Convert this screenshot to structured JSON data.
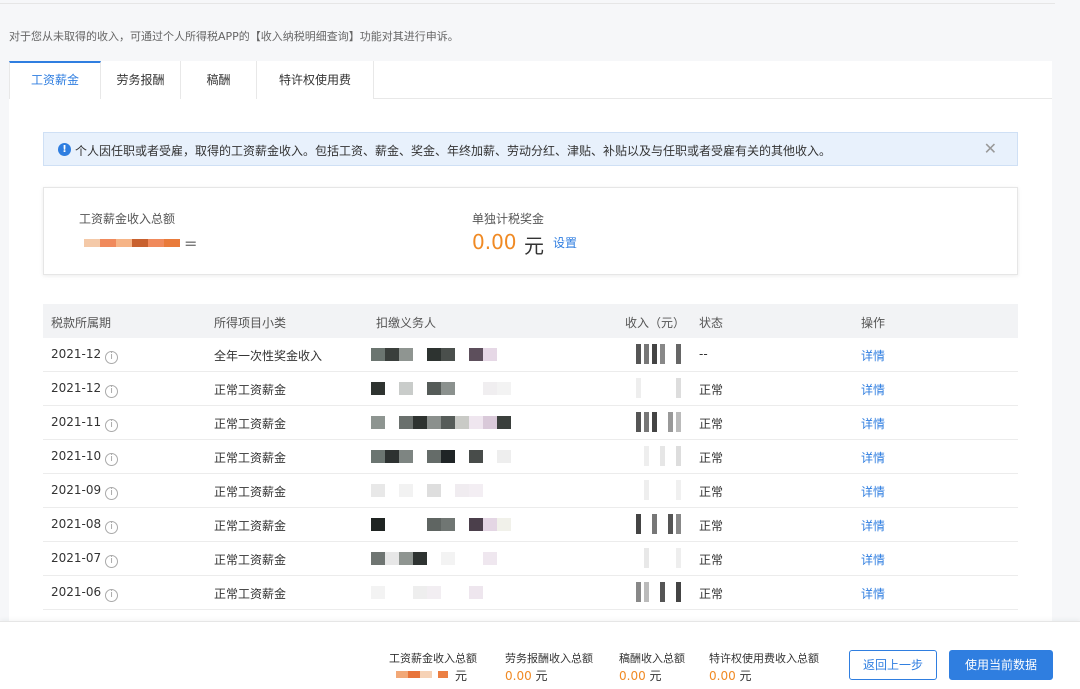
{
  "notice": "对于您从未取得的收入，可通过个人所得税APP的【收入纳税明细查询】功能对其进行申诉。",
  "tabs": [
    {
      "label": "工资薪金",
      "active": true
    },
    {
      "label": "劳务报酬",
      "active": false
    },
    {
      "label": "稿酬",
      "active": false
    },
    {
      "label": "特许权使用费",
      "active": false
    }
  ],
  "alert": {
    "text": "个人因任职或者受雇，取得的工资薪金收入。包括工资、薪金、奖金、年终加薪、劳动分红、津贴、补贴以及与任职或者受雇有关的其他收入。",
    "icon": "info-icon",
    "close": "✕"
  },
  "summary": {
    "total_label": "工资薪金收入总额",
    "bonus_label": "单独计税奖金",
    "bonus_value": "0.00",
    "bonus_unit": "元",
    "settings_link": "设置"
  },
  "table": {
    "headers": [
      "税款所属期",
      "所得项目小类",
      "扣缴义务人",
      "收入（元）",
      "状态",
      "操作"
    ],
    "rows": [
      {
        "period": "2021-12",
        "category": "全年一次性奖金收入",
        "status": "--",
        "action": "详情"
      },
      {
        "period": "2021-12",
        "category": "正常工资薪金",
        "status": "正常",
        "action": "详情"
      },
      {
        "period": "2021-11",
        "category": "正常工资薪金",
        "status": "正常",
        "action": "详情"
      },
      {
        "period": "2021-10",
        "category": "正常工资薪金",
        "status": "正常",
        "action": "详情"
      },
      {
        "period": "2021-09",
        "category": "正常工资薪金",
        "status": "正常",
        "action": "详情"
      },
      {
        "period": "2021-08",
        "category": "正常工资薪金",
        "status": "正常",
        "action": "详情"
      },
      {
        "period": "2021-07",
        "category": "正常工资薪金",
        "status": "正常",
        "action": "详情"
      },
      {
        "period": "2021-06",
        "category": "正常工资薪金",
        "status": "正常",
        "action": "详情"
      }
    ]
  },
  "footer": {
    "items": [
      {
        "label": "工资薪金收入总额",
        "value": "",
        "unit": "元"
      },
      {
        "label": "劳务报酬收入总额",
        "value": "0.00",
        "unit": "元"
      },
      {
        "label": "稿酬收入总额",
        "value": "0.00",
        "unit": "元"
      },
      {
        "label": "特许权使用费收入总额",
        "value": "0.00",
        "unit": "元"
      }
    ],
    "back_button": "返回上一步",
    "use_button": "使用当前数据"
  },
  "colors": {
    "accent": "#2f7ee0",
    "amount": "#f08a24"
  }
}
